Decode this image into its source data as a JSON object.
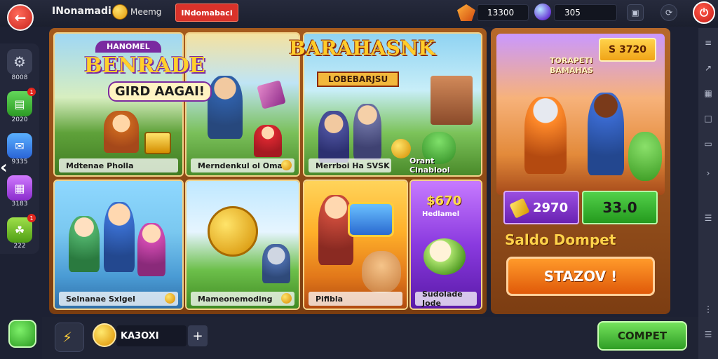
{
  "topbar": {
    "app_title": "INonamadi",
    "meta_label": "Meemg",
    "badge_label": "INdomabaci",
    "gems_value": "13300",
    "orbs_value": "305"
  },
  "sidebar": {
    "items": [
      {
        "label": "8008",
        "icon": "gear-icon"
      },
      {
        "label": "2020",
        "icon": "chart-icon",
        "badge": "1"
      },
      {
        "label": "9335",
        "icon": "chat-icon"
      },
      {
        "label": "3183",
        "icon": "bag-icon"
      },
      {
        "label": "222",
        "icon": "leaf-icon",
        "badge": "1"
      }
    ]
  },
  "grid": {
    "banner_top_left": {
      "line1": "HANOMEL",
      "line2": "BENRADE",
      "line3": "GIRD AAGAI!"
    },
    "banner_top_right": {
      "line1": "BARAHASNK",
      "line2": "LOBEBARJSU"
    },
    "cards": [
      {
        "caption": "Mdtenae Pholla"
      },
      {
        "caption": "Merndenkul ol Oma"
      },
      {
        "caption": "Merrboi Ha SVSK"
      },
      {
        "caption": "Orant Cinablool"
      },
      {
        "caption": "Selnanae Sxlgel"
      },
      {
        "caption": "Mameonemoding"
      },
      {
        "caption": "Pifibla"
      },
      {
        "caption": "Sudolade Jode"
      }
    ],
    "card8_price": "$670",
    "card8_sub": "Hedlamel"
  },
  "panel": {
    "price": "S 3720",
    "subtitle_line1": "TORAPETI",
    "subtitle_line2": "BAMAHAS",
    "stat_left": "2970",
    "stat_right": "33.0",
    "label": "Saldo Dompet",
    "cta": "STAZOV !"
  },
  "bottombar": {
    "amount": "KA3OXI",
    "plus": "+",
    "cta": "COMPET"
  },
  "colors": {
    "bg": "#1d2133",
    "frame": "#a55a1d",
    "accent_green": "#52d04a",
    "accent_purple": "#9a4ee0",
    "accent_orange": "#ff9a2a",
    "alert_red": "#d9322a"
  }
}
